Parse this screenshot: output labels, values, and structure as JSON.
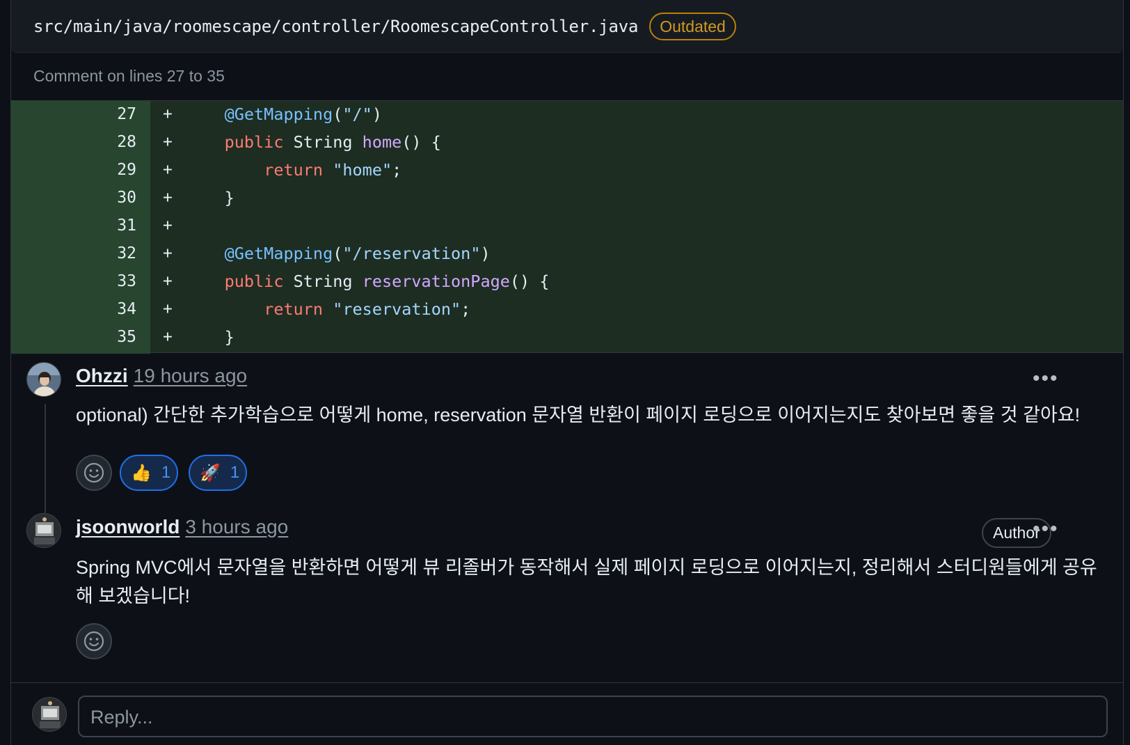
{
  "file": {
    "path": "src/main/java/roomescape/controller/RoomescapeController.java",
    "badge": "Outdated"
  },
  "comment_range": "Comment on lines 27 to 35",
  "diff": {
    "marker": "+",
    "lines": [
      {
        "num": "27",
        "tokens": [
          {
            "t": "    ",
            "c": ""
          },
          {
            "t": "@GetMapping",
            "c": "ann"
          },
          {
            "t": "(",
            "c": ""
          },
          {
            "t": "\"/\"",
            "c": "str"
          },
          {
            "t": ")",
            "c": ""
          }
        ]
      },
      {
        "num": "28",
        "tokens": [
          {
            "t": "    ",
            "c": ""
          },
          {
            "t": "public",
            "c": "kw"
          },
          {
            "t": " String ",
            "c": ""
          },
          {
            "t": "home",
            "c": "fn"
          },
          {
            "t": "() {",
            "c": ""
          }
        ]
      },
      {
        "num": "29",
        "tokens": [
          {
            "t": "        ",
            "c": ""
          },
          {
            "t": "return",
            "c": "kw"
          },
          {
            "t": " ",
            "c": ""
          },
          {
            "t": "\"home\"",
            "c": "str"
          },
          {
            "t": ";",
            "c": ""
          }
        ]
      },
      {
        "num": "30",
        "tokens": [
          {
            "t": "    }",
            "c": ""
          }
        ]
      },
      {
        "num": "31",
        "tokens": [
          {
            "t": "",
            "c": ""
          }
        ]
      },
      {
        "num": "32",
        "tokens": [
          {
            "t": "    ",
            "c": ""
          },
          {
            "t": "@GetMapping",
            "c": "ann"
          },
          {
            "t": "(",
            "c": ""
          },
          {
            "t": "\"/reservation\"",
            "c": "str"
          },
          {
            "t": ")",
            "c": ""
          }
        ]
      },
      {
        "num": "33",
        "tokens": [
          {
            "t": "    ",
            "c": ""
          },
          {
            "t": "public",
            "c": "kw"
          },
          {
            "t": " String ",
            "c": ""
          },
          {
            "t": "reservationPage",
            "c": "fn"
          },
          {
            "t": "() {",
            "c": ""
          }
        ]
      },
      {
        "num": "34",
        "tokens": [
          {
            "t": "        ",
            "c": ""
          },
          {
            "t": "return",
            "c": "kw"
          },
          {
            "t": " ",
            "c": ""
          },
          {
            "t": "\"reservation\"",
            "c": "str"
          },
          {
            "t": ";",
            "c": ""
          }
        ]
      },
      {
        "num": "35",
        "tokens": [
          {
            "t": "    }",
            "c": ""
          }
        ]
      }
    ]
  },
  "comments": [
    {
      "author": "Ohzzi",
      "time": "19 hours ago",
      "body": "optional) 간단한 추가학습으로 어떻게 home, reservation 문자열 반환이 페이지 로딩으로 이어지는지도 찾아보면 좋을 것 같아요!",
      "reactions": [
        {
          "emoji": "👍",
          "count": "1"
        },
        {
          "emoji": "🚀",
          "count": "1"
        }
      ]
    },
    {
      "author": "jsoonworld",
      "time": "3 hours ago",
      "badge": "Author",
      "body_line1": "Spring MVC에서 문자열을 반환하면 어떻게 뷰 리졸버가 동작해서 실제 페이지 로딩으로 이어지는지, 정리해서 스터디원들에게 공유",
      "body_line2": "해 보겠습니다!"
    }
  ],
  "reply": {
    "placeholder": "Reply..."
  },
  "colors": {
    "accent_blue": "#1f6feb",
    "outdated": "#d29922",
    "diff_add_bg": "#1d2d22",
    "diff_gutter_bg": "#27452f"
  }
}
